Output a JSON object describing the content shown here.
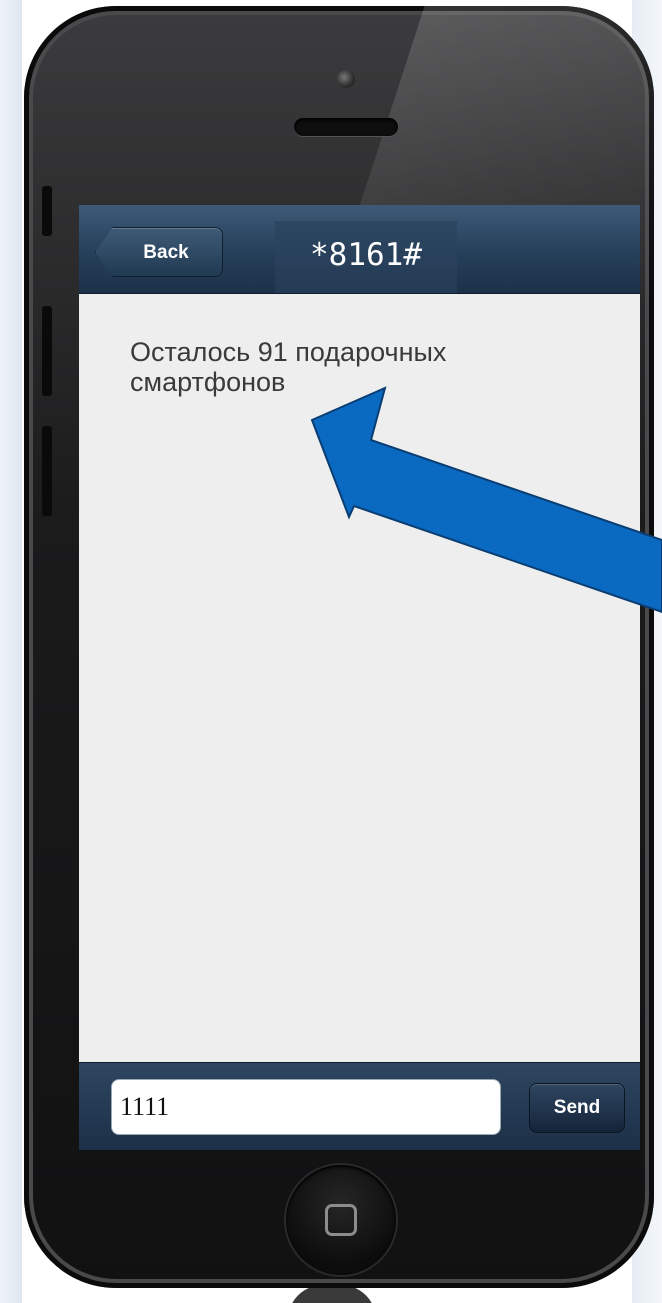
{
  "nav": {
    "back_label": "Back",
    "title": "*8161#"
  },
  "message": {
    "text": "Осталось 91 подарочных смартфонов"
  },
  "reply": {
    "value": "1111",
    "send_label": "Send"
  },
  "annotation": {
    "arrow_color": "#0a6ac2"
  },
  "icons": {
    "home": "home-button-icon",
    "camera": "front-camera-icon",
    "speaker": "earpiece-speaker-icon"
  },
  "colors": {
    "nav_bar": "#263f5a",
    "screen_background": "#eeeeee",
    "phone_body": "#1b1b1c"
  }
}
